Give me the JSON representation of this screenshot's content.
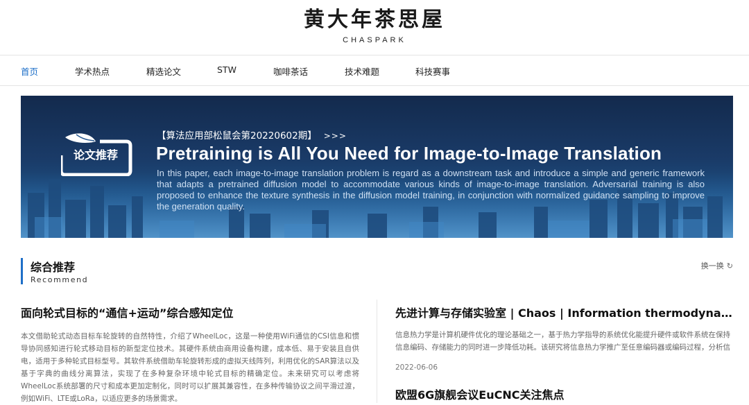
{
  "header": {
    "logo_cn": "黄大年茶思屋",
    "logo_en": "CHASPARK"
  },
  "nav": {
    "items": [
      "首页",
      "学术热点",
      "精选论文",
      "STW",
      "咖啡茶话",
      "技术难题",
      "科技赛事"
    ],
    "active_index": 0
  },
  "banner": {
    "badge": "论文推荐",
    "series": "【算法应用部松鼠会第20220602期】",
    "arrow": ">>>",
    "title": "Pretraining is All You Need for Image-to-Image Translation",
    "description": "In this paper, each image-to-image translation problem is regard as a downstream task and introduce a simple and generic framework that adapts a pretrained diffusion model to accommodate various kinds of image-to-image translation. Adversarial training is also proposed to enhance the texture synthesis in the diffusion model training, in conjunction with normalized guidance sampling to improve the generation quality."
  },
  "section": {
    "title": "综合推荐",
    "subtitle": "Recommend",
    "refresh_label": "换一换",
    "refresh_icon": "refresh-icon"
  },
  "featured": {
    "title": "面向轮式目标的“通信+运动”综合感知定位",
    "description": "本文借助轮式动态目标车轮旋转的自然特性，介绍了WheelLoc，这是一种使用WiFi通信的CSI信息和惯导协同感知进行轮式移动目标的新型定位技术。其硬件系统由商用设备构建，成本低、易于安装且自供电，适用于多种轮式目标型号。其软件系统借助车轮旋转形成的虚拟天线阵列，利用优化的SAR算法以及基于字典的曲线分离算法，实现了在多种复杂环境中轮式目标的精确定位。未来研究可以考虑将WheelLoc系统部署的尺寸和成本更加定制化，同时可以扩展其兼容性，在多种传输协议之间平滑过渡，例如WiFi、LTE或LoRa，以适应更多的场景需求。"
  },
  "side_articles": [
    {
      "title": "先进计算与存储实验室 | Chaos | Information thermodynamics ...",
      "description": "信息热力学是计算机硬件优化的理论基础之一，基于热力学指导的系统优化能提升硬件或软件系统在保持信息编码、存储能力的同时进一步降低功耗。该研究将信息热力学推广至任意编码器或编码过程，分析信息...",
      "date": "2022-06-06"
    },
    {
      "title": "欧盟6G旗舰会议EuCNC关注焦点"
    }
  ],
  "colors": {
    "accent": "#1e6fc8",
    "banner_bg": "#1a3b68"
  }
}
